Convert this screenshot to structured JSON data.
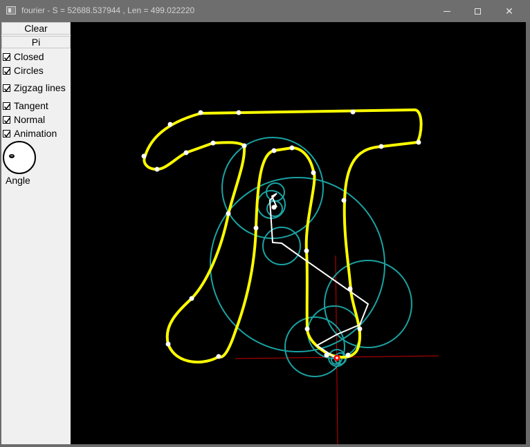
{
  "window": {
    "title": "fourier - S = 52688.537944 , Len = 499.022220",
    "min_icon": "minimize-icon",
    "max_icon": "maximize-icon",
    "close_icon": "close-icon",
    "close_glyph": "✕"
  },
  "panel": {
    "clear_label": "Clear",
    "pi_label": "Pi",
    "checkboxes": [
      {
        "label": "Closed",
        "checked": true
      },
      {
        "label": "Circles",
        "checked": true
      },
      {
        "label": "Zigzag lines",
        "checked": true
      },
      {
        "label": "Tangent",
        "checked": true
      },
      {
        "label": "Normal",
        "checked": true
      },
      {
        "label": "Animation",
        "checked": true
      }
    ],
    "angle_label": "Angle"
  },
  "colors": {
    "curve": "#ffff00",
    "circles": "#1aa3a3",
    "zigzag": "#ffffff",
    "axes": "#cc0000",
    "control_points": "#ffffff"
  }
}
